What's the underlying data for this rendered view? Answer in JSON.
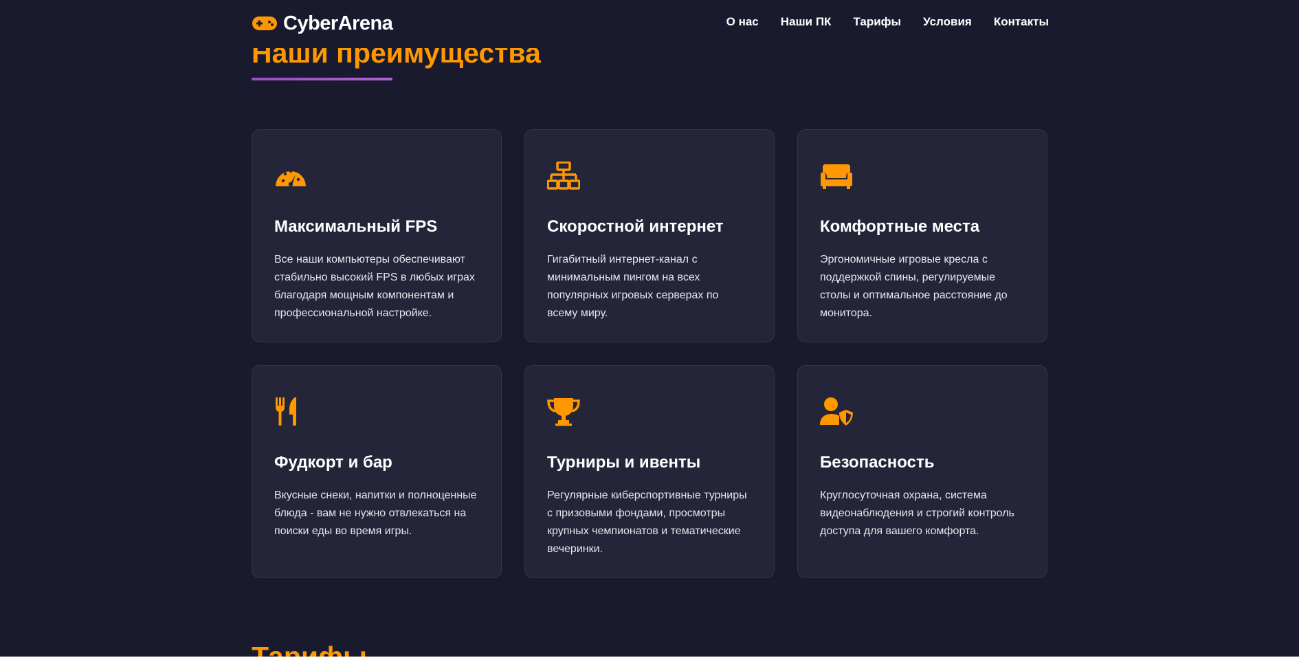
{
  "brand": {
    "name": "CyberArena",
    "icon": "gamepad-icon",
    "accent": "#ff9800",
    "underline": "#9b4dca"
  },
  "nav": {
    "items": [
      {
        "label": "О нас"
      },
      {
        "label": "Наши ПК"
      },
      {
        "label": "Тарифы"
      },
      {
        "label": "Условия"
      },
      {
        "label": "Контакты"
      }
    ]
  },
  "advantages": {
    "title": "Наши преимущества",
    "cards": [
      {
        "icon": "speedometer-icon",
        "title": "Максимальный FPS",
        "text": "Все наши компьютеры обеспечивают стабильно высокий FPS в любых играх благодаря мощным компонентам и профессиональной настройке."
      },
      {
        "icon": "network-icon",
        "title": "Скоростной интернет",
        "text": "Гигабитный интернет-канал с минимальным пингом на всех популярных игровых серверах по всему миру."
      },
      {
        "icon": "couch-icon",
        "title": "Комфортные места",
        "text": "Эргономичные игровые кресла с поддержкой спины, регулируемые столы и оптимальное расстояние до монитора."
      },
      {
        "icon": "utensils-icon",
        "title": "Фудкорт и бар",
        "text": "Вкусные снеки, напитки и полноценные блюда - вам не нужно отвлекаться на поиски еды во время игры."
      },
      {
        "icon": "trophy-icon",
        "title": "Турниры и ивенты",
        "text": "Регулярные киберспортивные турниры с призовыми фондами, просмотры крупных чемпионатов и тематические вечеринки."
      },
      {
        "icon": "user-shield-icon",
        "title": "Безопасность",
        "text": "Круглосуточная охрана, система видеонаблюдения и строгий контроль доступа для вашего комфорта."
      }
    ]
  },
  "pricing": {
    "title": "Тарифы"
  }
}
